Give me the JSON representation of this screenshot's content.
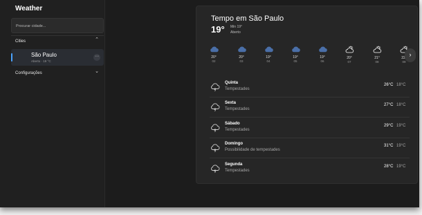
{
  "app": {
    "title": "Weather"
  },
  "search": {
    "placeholder": "Procurar cidade..."
  },
  "sidebar": {
    "cities_label": "Cities",
    "settings_label": "Configurações",
    "cities": [
      {
        "name": "São Paulo",
        "subtitle": "Aberto · 19 °C"
      }
    ]
  },
  "current": {
    "title": "Tempo em São Paulo",
    "temperature": "19°",
    "min": "Min 19°",
    "condition": "Aberto"
  },
  "hourly": [
    {
      "temp": "20°",
      "hour": "02",
      "icon": "cloud-icon"
    },
    {
      "temp": "20°",
      "hour": "03",
      "icon": "cloud-icon"
    },
    {
      "temp": "19°",
      "hour": "04",
      "icon": "cloud-icon"
    },
    {
      "temp": "19°",
      "hour": "05",
      "icon": "cloud-icon"
    },
    {
      "temp": "19°",
      "hour": "06",
      "icon": "cloud-icon"
    },
    {
      "temp": "20°",
      "hour": "07",
      "icon": "partly-cloudy-icon"
    },
    {
      "temp": "21°",
      "hour": "08",
      "icon": "partly-cloudy-icon"
    },
    {
      "temp": "22°",
      "hour": "09",
      "icon": "partly-cloudy-icon"
    }
  ],
  "daily": [
    {
      "day": "Quinta",
      "condition": "Tempestades",
      "high": "26°C",
      "low": "18°C"
    },
    {
      "day": "Sexta",
      "condition": "Tempestades",
      "high": "27°C",
      "low": "18°C"
    },
    {
      "day": "Sábado",
      "condition": "Tempestades",
      "high": "29°C",
      "low": "19°C"
    },
    {
      "day": "Domingo",
      "condition": "Possibilidade de tempestades",
      "high": "31°C",
      "low": "19°C"
    },
    {
      "day": "Segunda",
      "condition": "Tempestades",
      "high": "28°C",
      "low": "19°C"
    }
  ],
  "colors": {
    "accent": "#4aa3ff",
    "hourly_icon": "#4a6fa8",
    "window_bg": "#1c1c1c",
    "panel_bg": "#262626"
  }
}
